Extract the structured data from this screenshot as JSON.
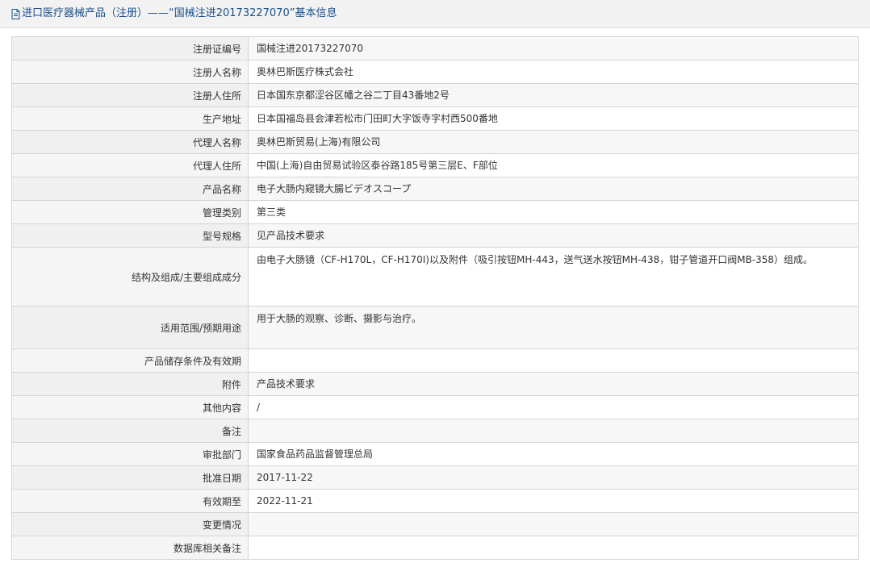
{
  "header": {
    "title": "进口医疗器械产品（注册）——“国械注进20173227070”基本信息",
    "icon": "document-icon"
  },
  "rows": [
    {
      "label": "注册证编号",
      "value": "国械注进20173227070"
    },
    {
      "label": "注册人名称",
      "value": "奥林巴斯医疗株式会社"
    },
    {
      "label": "注册人住所",
      "value": "日本国东京都涩谷区幡之谷二丁目43番地2号"
    },
    {
      "label": "生产地址",
      "value": "日本国福岛县会津若松市门田町大字饭寺字村西500番地"
    },
    {
      "label": "代理人名称",
      "value": "奥林巴斯贸易(上海)有限公司"
    },
    {
      "label": "代理人住所",
      "value": "中国(上海)自由贸易试验区泰谷路185号第三层E、F部位"
    },
    {
      "label": "产品名称",
      "value": "电子大肠内窥镜大腸ビデオスコープ"
    },
    {
      "label": "管理类别",
      "value": "第三类"
    },
    {
      "label": "型号规格",
      "value": "见产品技术要求"
    },
    {
      "label": "结构及组成/主要组成成分",
      "value": "由电子大肠镜（CF-H170L，CF-H170I)以及附件（吸引按钮MH-443，送气送水按钮MH-438，钳子管道开口阀MB-358）组成。"
    },
    {
      "label": "适用范围/预期用途",
      "value": "用于大肠的观察、诊断、摄影与治疗。"
    },
    {
      "label": "产品储存条件及有效期",
      "value": ""
    },
    {
      "label": "附件",
      "value": "产品技术要求"
    },
    {
      "label": "其他内容",
      "value": "/"
    },
    {
      "label": "备注",
      "value": ""
    },
    {
      "label": "审批部门",
      "value": "国家食品药品监督管理总局"
    },
    {
      "label": "批准日期",
      "value": "2017-11-22"
    },
    {
      "label": "有效期至",
      "value": "2022-11-21"
    },
    {
      "label": "变更情况",
      "value": ""
    },
    {
      "label": "数据库相关备注",
      "value": ""
    }
  ]
}
